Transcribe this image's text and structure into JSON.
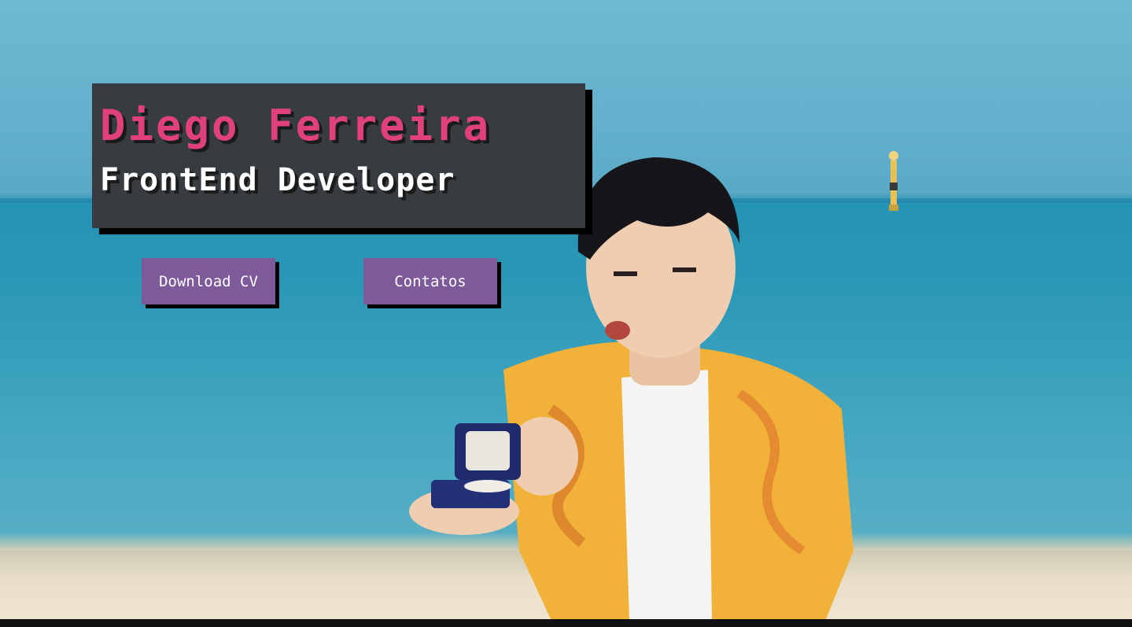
{
  "hero": {
    "name": "Diego Ferreira",
    "role": "FrontEnd Developer"
  },
  "actions": {
    "download_cv_label": "Download CV",
    "contacts_label": "Contatos"
  },
  "colors": {
    "name_accent": "#e0417a",
    "button_bg": "#7e5a9b",
    "card_bg": "#373c40"
  }
}
